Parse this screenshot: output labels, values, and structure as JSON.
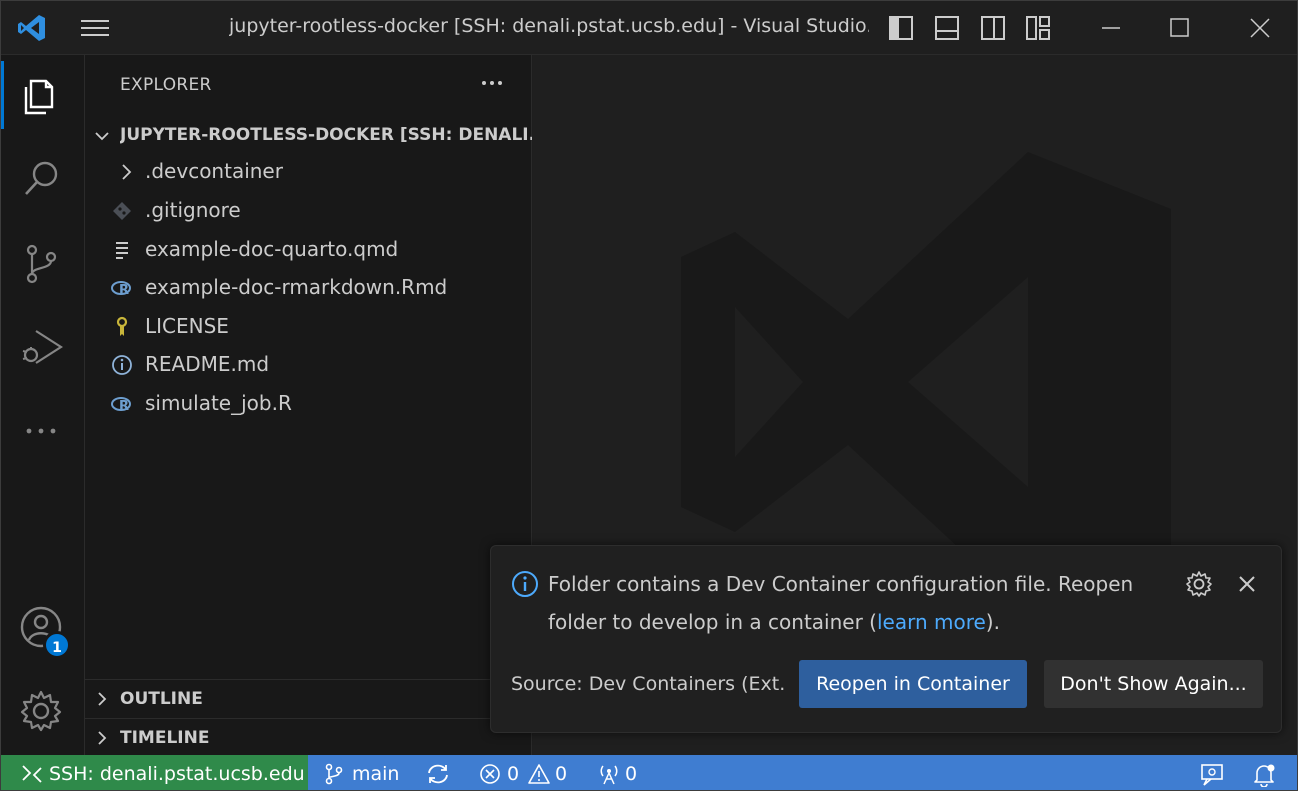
{
  "window": {
    "title": "jupyter-rootless-docker [SSH: denali.pstat.ucsb.edu] - Visual Studio..."
  },
  "icons": {
    "app": "vscode-logo-icon",
    "menu": "hamburger-menu-icon",
    "layout": [
      "toggle-primary-sidebar-icon",
      "toggle-panel-icon",
      "toggle-secondary-sidebar-icon",
      "customize-layout-icon"
    ],
    "window_controls": [
      "minimize-icon",
      "maximize-icon",
      "close-icon"
    ]
  },
  "activity_bar": {
    "items": [
      "explorer-icon",
      "search-icon",
      "source-control-icon",
      "run-debug-icon",
      "more-icon"
    ],
    "accounts_badge": "1"
  },
  "sidebar": {
    "title": "EXPLORER",
    "root": "JUPYTER-ROOTLESS-DOCKER [SSH: DENALI...",
    "files": [
      {
        "name": ".devcontainer",
        "icon": "chevron-right-icon"
      },
      {
        "name": ".gitignore",
        "icon": "git-icon"
      },
      {
        "name": "example-doc-quarto.qmd",
        "icon": "text-lines-icon"
      },
      {
        "name": "example-doc-rmarkdown.Rmd",
        "icon": "r-icon"
      },
      {
        "name": "LICENSE",
        "icon": "license-key-icon"
      },
      {
        "name": "README.md",
        "icon": "info-icon"
      },
      {
        "name": "simulate_job.R",
        "icon": "r-icon"
      }
    ],
    "outline": "OUTLINE",
    "timeline": "TIMELINE"
  },
  "notification": {
    "line1": "Folder contains a Dev Container configuration file. Reopen",
    "line2_before": "folder to develop in a container (",
    "link": "learn more",
    "line2_after": ").",
    "source": "Source: Dev Containers (Ext...",
    "primary_button": "Reopen in Container",
    "secondary_button": "Don't Show Again..."
  },
  "statusbar": {
    "remote": "SSH: denali.pstat.ucsb.edu",
    "branch": "main",
    "errors": "0",
    "warnings": "0",
    "ports": "0"
  },
  "colors": {
    "accent": "#0078d4",
    "statusbar": "#3f7dd1",
    "remote": "#2f8a4a",
    "link": "#4daafc"
  }
}
